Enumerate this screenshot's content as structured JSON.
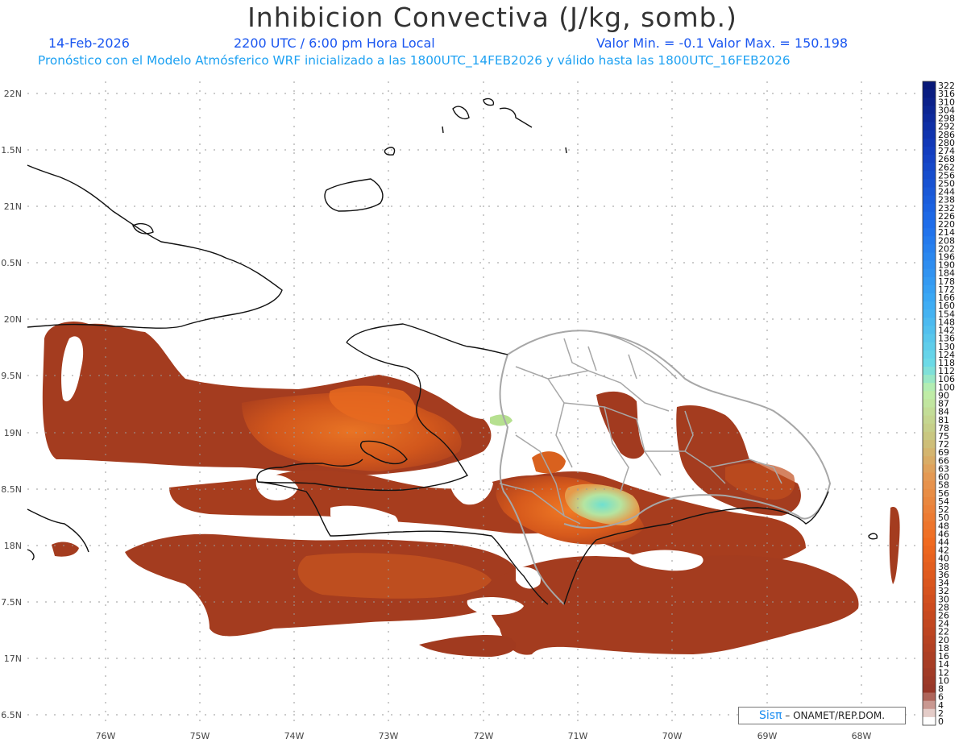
{
  "title": "Inhibicion Convectiva (J/kg, somb.)",
  "date": "14-Feb-2026",
  "time": "2200 UTC / 6:00 pm Hora Local",
  "minmax": "Valor Min. = -0.1  Valor Max. = 150.198",
  "forecast_note": "Pronóstico con el Modelo Atmósferico WRF inicializado a las 1800UTC_14FEB2026 y válido hasta las  1800UTC_16FEB2026",
  "credit_brand": "Sisπ",
  "credit_text": "– ONAMET/REP.DOM.",
  "lat_labels": [
    "22N",
    "1.5N",
    "21N",
    "0.5N",
    "20N",
    "9.5N",
    "19N",
    "8.5N",
    "18N",
    "7.5N",
    "17N",
    "6.5N"
  ],
  "lon_labels": [
    "76W",
    "75W",
    "74W",
    "73W",
    "72W",
    "71W",
    "70W",
    "69W",
    "68W"
  ],
  "colorbar": {
    "labels": [
      "322",
      "316",
      "310",
      "304",
      "298",
      "292",
      "286",
      "280",
      "274",
      "268",
      "262",
      "256",
      "250",
      "244",
      "238",
      "232",
      "226",
      "220",
      "214",
      "208",
      "202",
      "196",
      "190",
      "184",
      "178",
      "172",
      "166",
      "160",
      "154",
      "148",
      "142",
      "136",
      "130",
      "124",
      "118",
      "112",
      "106",
      "100",
      "90",
      "87",
      "84",
      "81",
      "78",
      "75",
      "72",
      "69",
      "66",
      "63",
      "60",
      "58",
      "56",
      "54",
      "52",
      "50",
      "48",
      "46",
      "44",
      "42",
      "40",
      "38",
      "36",
      "34",
      "32",
      "30",
      "28",
      "26",
      "24",
      "22",
      "20",
      "18",
      "16",
      "14",
      "12",
      "10",
      "8",
      "6",
      "4",
      "2",
      "0"
    ]
  },
  "colors": {
    "low": "#8f3520",
    "mid": "#c24b1c",
    "orange": "#e2651b",
    "high_green": "#aee0a0",
    "cyan": "#7ee6d6"
  }
}
